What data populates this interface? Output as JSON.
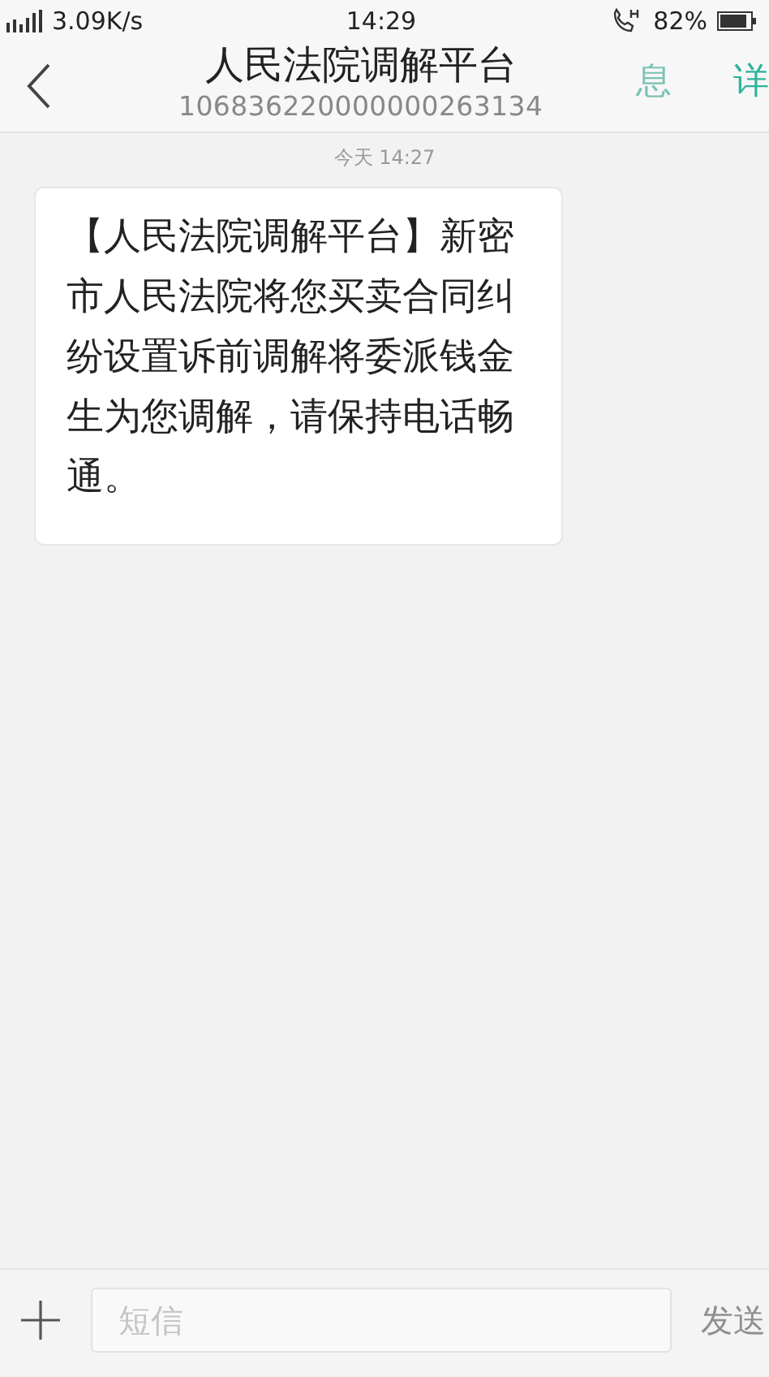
{
  "status_bar": {
    "network": "3.09K/s",
    "time": "14:29",
    "battery": "82%"
  },
  "header": {
    "title": "人民法院调解平台",
    "number": "106836220000000263134",
    "faded_action": "息",
    "action": "详"
  },
  "timestamp": "今天 14:27",
  "messages": [
    {
      "text": "【人民法院调解平台】新密市人民法院将您买卖合同纠纷设置诉前调解将委派钱金生为您调解，请保持电话畅通。"
    }
  ],
  "composer": {
    "placeholder": "短信",
    "send": "发送",
    "send_disabled": true
  }
}
